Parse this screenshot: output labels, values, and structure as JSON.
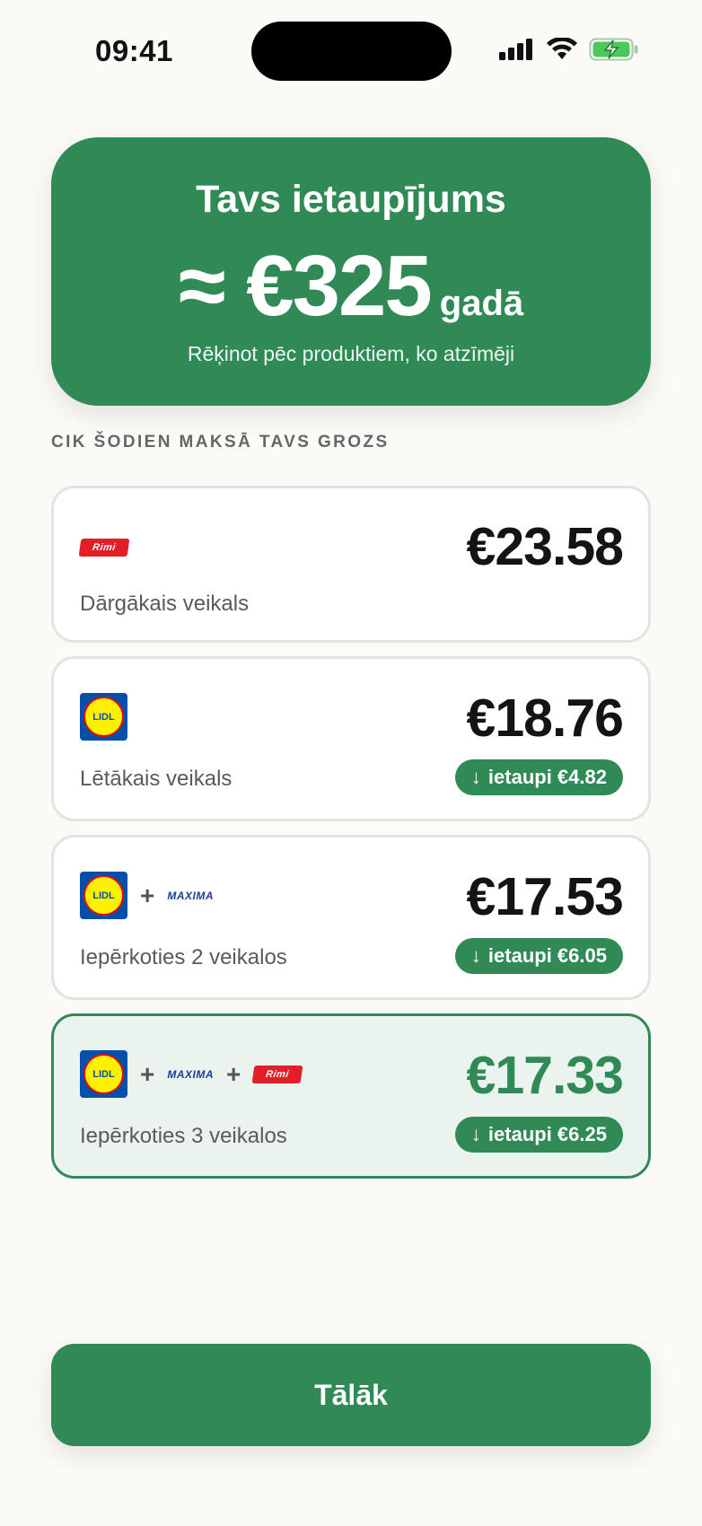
{
  "status_bar": {
    "time": "09:41"
  },
  "hero": {
    "title": "Tavs ietaupījums",
    "amount": "≈ €325",
    "period": "gadā",
    "caption": "Rēķinot pēc produktiem, ko atzīmēji"
  },
  "section": {
    "label": "CIK ŠODIEN MAKSĀ TAVS GROZS"
  },
  "stores": {
    "rimi": "Rimi",
    "lidl": "LIDL",
    "maxima": "MAXIMA"
  },
  "cards": [
    {
      "price": "€23.58",
      "label": "Dārgākais veikals",
      "savings": ""
    },
    {
      "price": "€18.76",
      "label": "Lētākais veikals",
      "savings": "ietaupi €4.82"
    },
    {
      "price": "€17.53",
      "label": "Iepērkoties 2 veikalos",
      "savings": "ietaupi €6.05"
    },
    {
      "price": "€17.33",
      "label": "Iepērkoties 3 veikalos",
      "savings": "ietaupi €6.25"
    }
  ],
  "plus_sign": "+",
  "arrow": "↓",
  "cta": {
    "label": "Tālāk"
  },
  "colors": {
    "accent": "#2F8A56",
    "background": "#FBFAF6",
    "best_card_bg": "#EAF3EE"
  }
}
